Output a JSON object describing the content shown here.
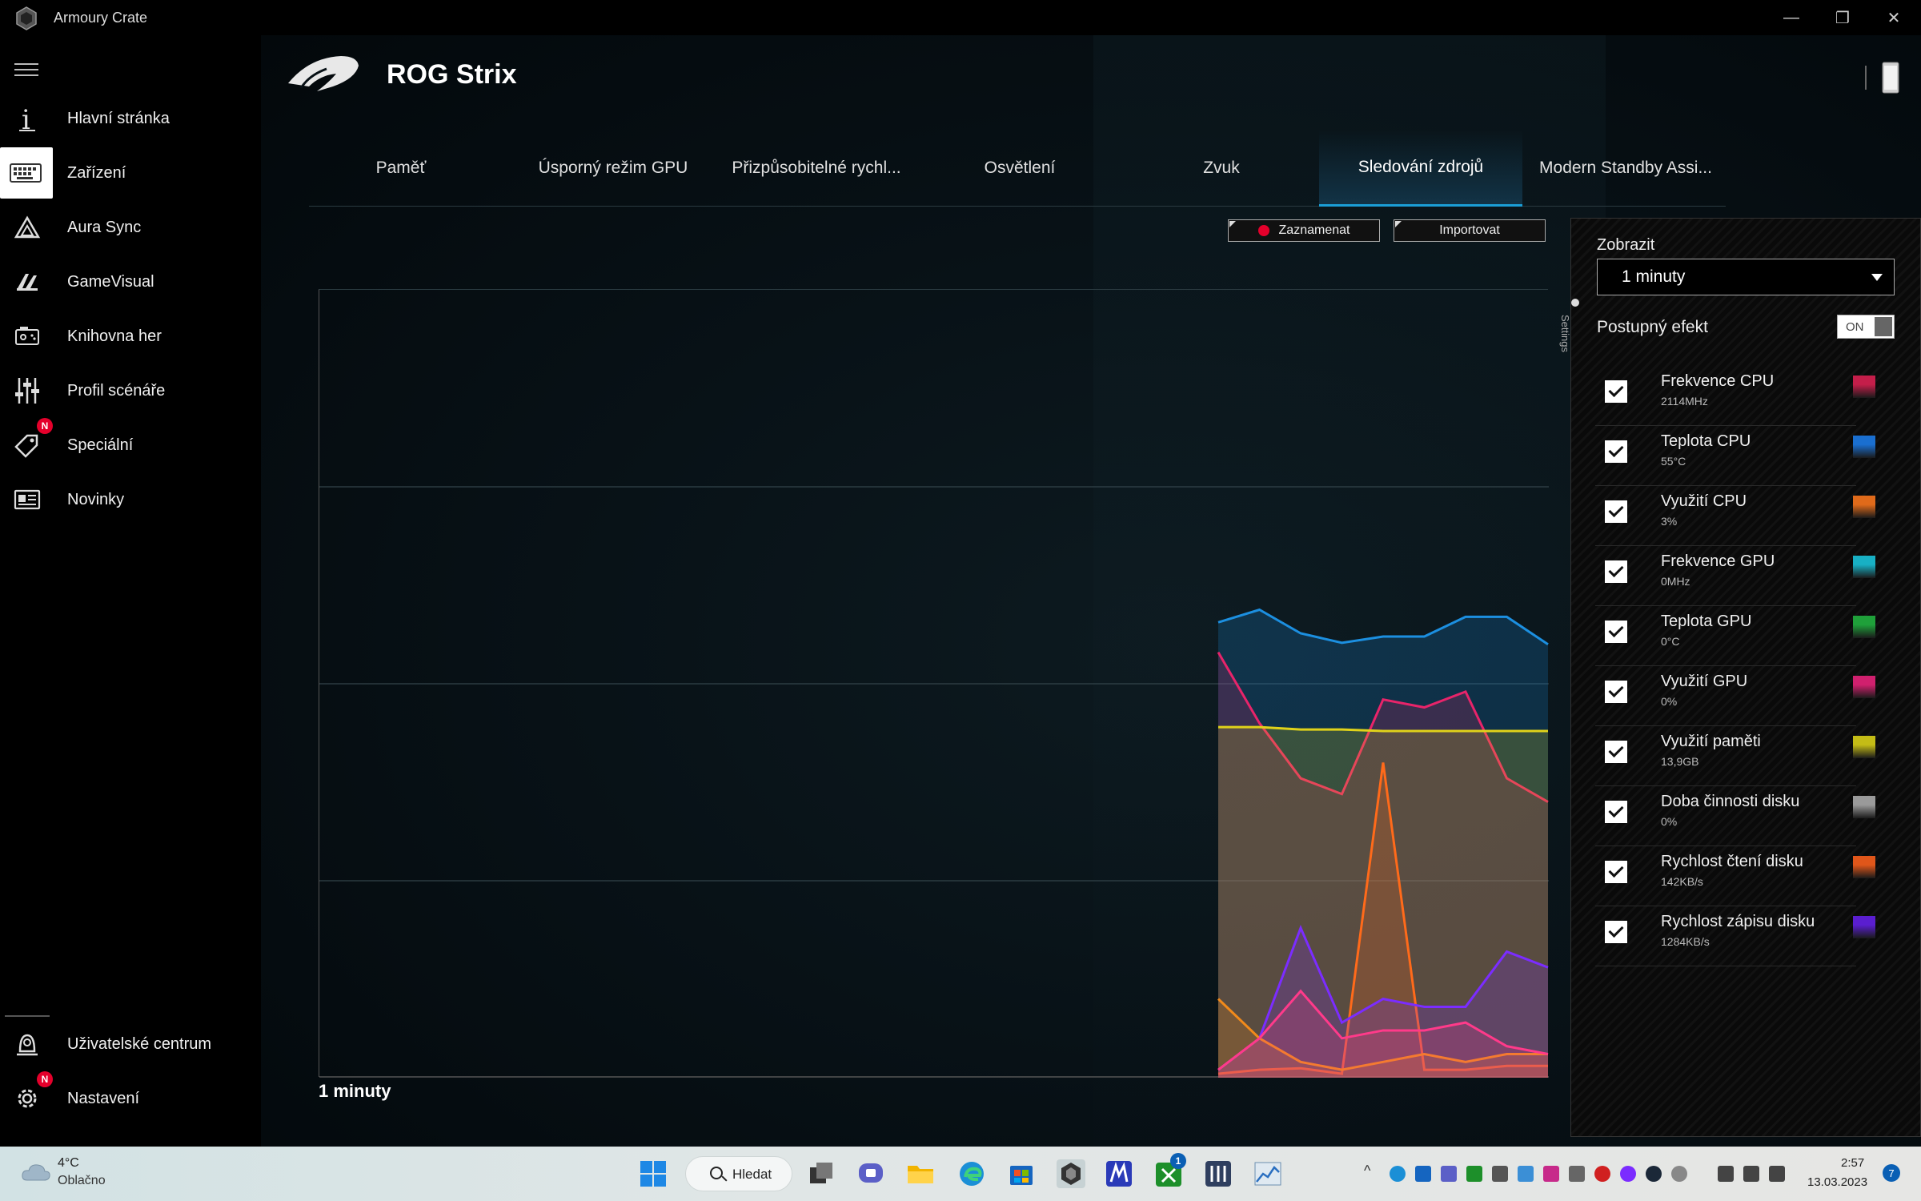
{
  "window": {
    "title": "Armoury Crate",
    "minimize": "—",
    "restore": "❐",
    "close": "✕"
  },
  "sidebar": {
    "items": [
      {
        "label": "Hlavní stránka",
        "icon": "home-icon"
      },
      {
        "label": "Zařízení",
        "icon": "keyboard-icon",
        "active": true
      },
      {
        "label": "Aura Sync",
        "icon": "aura-icon"
      },
      {
        "label": "GameVisual",
        "icon": "gamevisual-icon"
      },
      {
        "label": "Knihovna her",
        "icon": "game-library-icon"
      },
      {
        "label": "Profil scénáře",
        "icon": "sliders-icon"
      },
      {
        "label": "Speciální",
        "icon": "tag-icon",
        "badge": "N"
      },
      {
        "label": "Novinky",
        "icon": "news-icon"
      }
    ],
    "bottom_items": [
      {
        "label": "Uživatelské centrum",
        "icon": "user-center-icon"
      },
      {
        "label": "Nastavení",
        "icon": "gear-icon",
        "badge": "N"
      }
    ]
  },
  "header": {
    "device_title": "ROG Strix"
  },
  "tabs": [
    {
      "label": "Paměť"
    },
    {
      "label": "Úsporný režim GPU"
    },
    {
      "label": "Přizpůsobitelné rychl..."
    },
    {
      "label": "Osvětlení"
    },
    {
      "label": "Zvuk"
    },
    {
      "label": "Sledování zdrojů",
      "active": true
    },
    {
      "label": "Modern Standby Assi..."
    }
  ],
  "toolbar": {
    "record_label": "Zaznamenat",
    "import_label": "Importovat"
  },
  "chart_label": "1 minuty",
  "chart_data": {
    "type": "area",
    "title": "",
    "x_window": "1 minuty",
    "grid": true,
    "ylim": [
      0,
      100
    ],
    "x": [
      0,
      1,
      2,
      3,
      4,
      5,
      6,
      7,
      8
    ],
    "series": [
      {
        "name": "Teplota CPU",
        "color": "#1c8fe0",
        "values": [
          57.8,
          59.4,
          56.4,
          55.2,
          56.0,
          56.0,
          58.5,
          58.5,
          55.0
        ]
      },
      {
        "name": "Frekvence CPU",
        "color": "#e8246a",
        "values": [
          54,
          45,
          38,
          36,
          48,
          47,
          49,
          38,
          35
        ]
      },
      {
        "name": "Využití paměti",
        "color": "#e0d21a",
        "values": [
          44.5,
          44.5,
          44.2,
          44.2,
          44.0,
          44.0,
          44.0,
          44.0,
          44.0
        ]
      },
      {
        "name": "Rychlost čtení disku",
        "color": "#ff6a1a",
        "values": [
          0.5,
          1.0,
          1.2,
          0.5,
          40,
          1.0,
          1.0,
          1.5,
          1.5
        ]
      },
      {
        "name": "Rychlost zápisu disku",
        "color": "#7b2cff",
        "values": [
          1,
          5,
          19,
          7,
          10,
          9,
          9,
          16,
          14
        ]
      },
      {
        "name": "Využití CPU",
        "color": "#f28a1a",
        "values": [
          10,
          5,
          2,
          1,
          2,
          3,
          2,
          3,
          3
        ]
      },
      {
        "name": "Využití GPU",
        "color": "#ff3a8a",
        "values": [
          1,
          5,
          11,
          5,
          6,
          6,
          7,
          4,
          3
        ]
      }
    ]
  },
  "panel": {
    "vertical_tab": "Settings",
    "display_label": "Zobrazit",
    "display_value": "1 minuty",
    "progressive_label": "Postupný efekt",
    "toggle_label": "ON",
    "metrics": [
      {
        "name": "Frekvence CPU",
        "value": "2114MHz",
        "color": "#c41e4a"
      },
      {
        "name": "Teplota CPU",
        "value": "55°C",
        "color": "#1a6fd0"
      },
      {
        "name": "Využití CPU",
        "value": "3%",
        "color": "#e06a1a"
      },
      {
        "name": "Frekvence GPU",
        "value": "0MHz",
        "color": "#18b0c4"
      },
      {
        "name": "Teplota GPU",
        "value": "0°C",
        "color": "#1fa03a"
      },
      {
        "name": "Využití GPU",
        "value": "0%",
        "color": "#d0206e"
      },
      {
        "name": "Využití paměti",
        "value": "13,9GB",
        "color": "#c4bc16"
      },
      {
        "name": "Doba činnosti disku",
        "value": "0%",
        "color": "#9a9a9a"
      },
      {
        "name": "Rychlost čtení disku",
        "value": "142KB/s",
        "color": "#e0561a"
      },
      {
        "name": "Rychlost zápisu disku",
        "value": "1284KB/s",
        "color": "#5a1ed0"
      }
    ]
  },
  "taskbar": {
    "weather_temp": "4°C",
    "weather_desc": "Oblačno",
    "search_label": "Hledat",
    "time": "2:57",
    "date": "13.03.2023",
    "notifications": "7",
    "teams_badge": "1"
  }
}
